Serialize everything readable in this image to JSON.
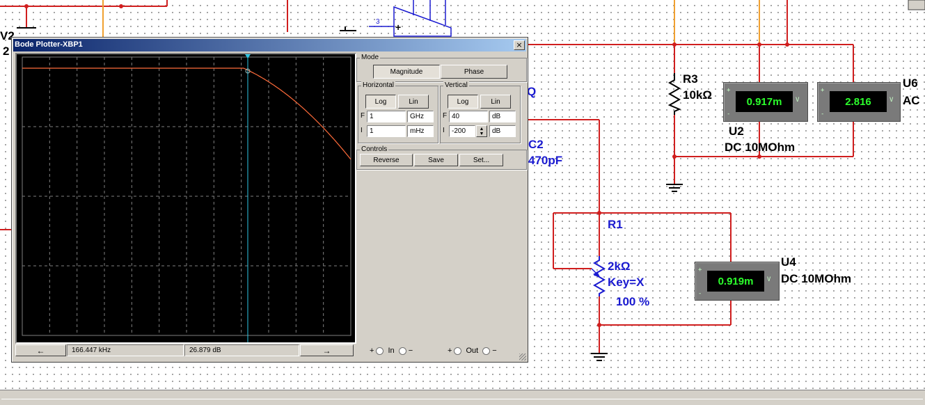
{
  "window": {
    "title": "Bode Plotter-XBP1",
    "close_glyph": "×"
  },
  "mode": {
    "label": "Mode",
    "magnitude": "Magnitude",
    "phase": "Phase"
  },
  "horizontal": {
    "label": "Horizontal",
    "log": "Log",
    "lin": "Lin",
    "f_label": "F",
    "f_value": "1",
    "f_unit": "GHz",
    "i_label": "I",
    "i_value": "1",
    "i_unit": "mHz"
  },
  "vertical": {
    "label": "Vertical",
    "log": "Log",
    "lin": "Lin",
    "f_label": "F",
    "f_value": "40",
    "f_unit": "dB",
    "i_label": "I",
    "i_value": "-200",
    "i_unit": "dB"
  },
  "controls": {
    "label": "Controls",
    "reverse": "Reverse",
    "save": "Save",
    "set": "Set..."
  },
  "readout": {
    "left_arrow": "←",
    "right_arrow": "→",
    "frequency": "166.447 kHz",
    "magnitude": "26.879 dB"
  },
  "terminals": {
    "in_plus": "+",
    "in_label": "In",
    "in_minus": "−",
    "out_plus": "+",
    "out_label": "Out",
    "out_minus": "−"
  },
  "plot_colors": {
    "trace": "#ff6b3a",
    "cursor": "#2ec8e6",
    "grid": "#808080"
  },
  "schematic": {
    "partial_v2": "V2",
    "partial_2": "2",
    "partial_q": "Q",
    "opamp_pin": "3",
    "opamp_plus": "+",
    "c2_name": "C2",
    "c2_value": "470pF",
    "r3_name": "R3",
    "r3_value": "10kΩ",
    "r1_name": "R1",
    "r1_value": "2kΩ",
    "r1_key": "Key=X",
    "r1_percent": "100 %",
    "u2_name": "U2",
    "u2_mode": "DC  10MOhm",
    "u2_reading": "0.917m",
    "u6_name": "U6",
    "u6_mode": "AC",
    "u6_reading": "2.816",
    "u4_name": "U4",
    "u4_mode": "DC  10MOhm",
    "u4_reading": "0.919m",
    "wire_color": "#d01e1e",
    "probe_wire_color": "#f0a030"
  }
}
